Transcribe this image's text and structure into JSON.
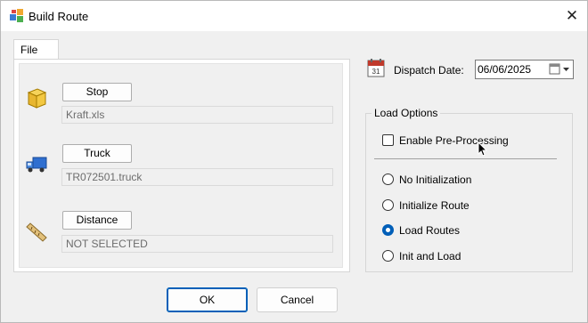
{
  "window": {
    "title": "Build Route"
  },
  "tabs": [
    {
      "label": "File"
    }
  ],
  "file_panel": {
    "stop": {
      "button": "Stop",
      "value": "Kraft.xls"
    },
    "truck": {
      "button": "Truck",
      "value": "TR072501.truck"
    },
    "distance": {
      "button": "Distance",
      "value": "NOT SELECTED"
    }
  },
  "dispatch": {
    "label": "Dispatch Date:",
    "value": "06/06/2025"
  },
  "load_options": {
    "title": "Load Options",
    "preprocessing": {
      "label": "Enable Pre-Processing",
      "checked": false
    },
    "radios": [
      {
        "label": "No Initialization",
        "selected": false
      },
      {
        "label": "Initialize Route",
        "selected": false
      },
      {
        "label": "Load Routes",
        "selected": true
      },
      {
        "label": "Init and Load",
        "selected": false
      }
    ]
  },
  "footer": {
    "ok": "OK",
    "cancel": "Cancel"
  },
  "colors": {
    "accent": "#005fb8",
    "panel": "#f0f0f0"
  },
  "icons": [
    "app-icon",
    "close-icon",
    "stop-box-icon",
    "truck-icon",
    "ruler-icon",
    "calendar-icon",
    "dropdown-icon",
    "mouse-cursor-icon"
  ]
}
